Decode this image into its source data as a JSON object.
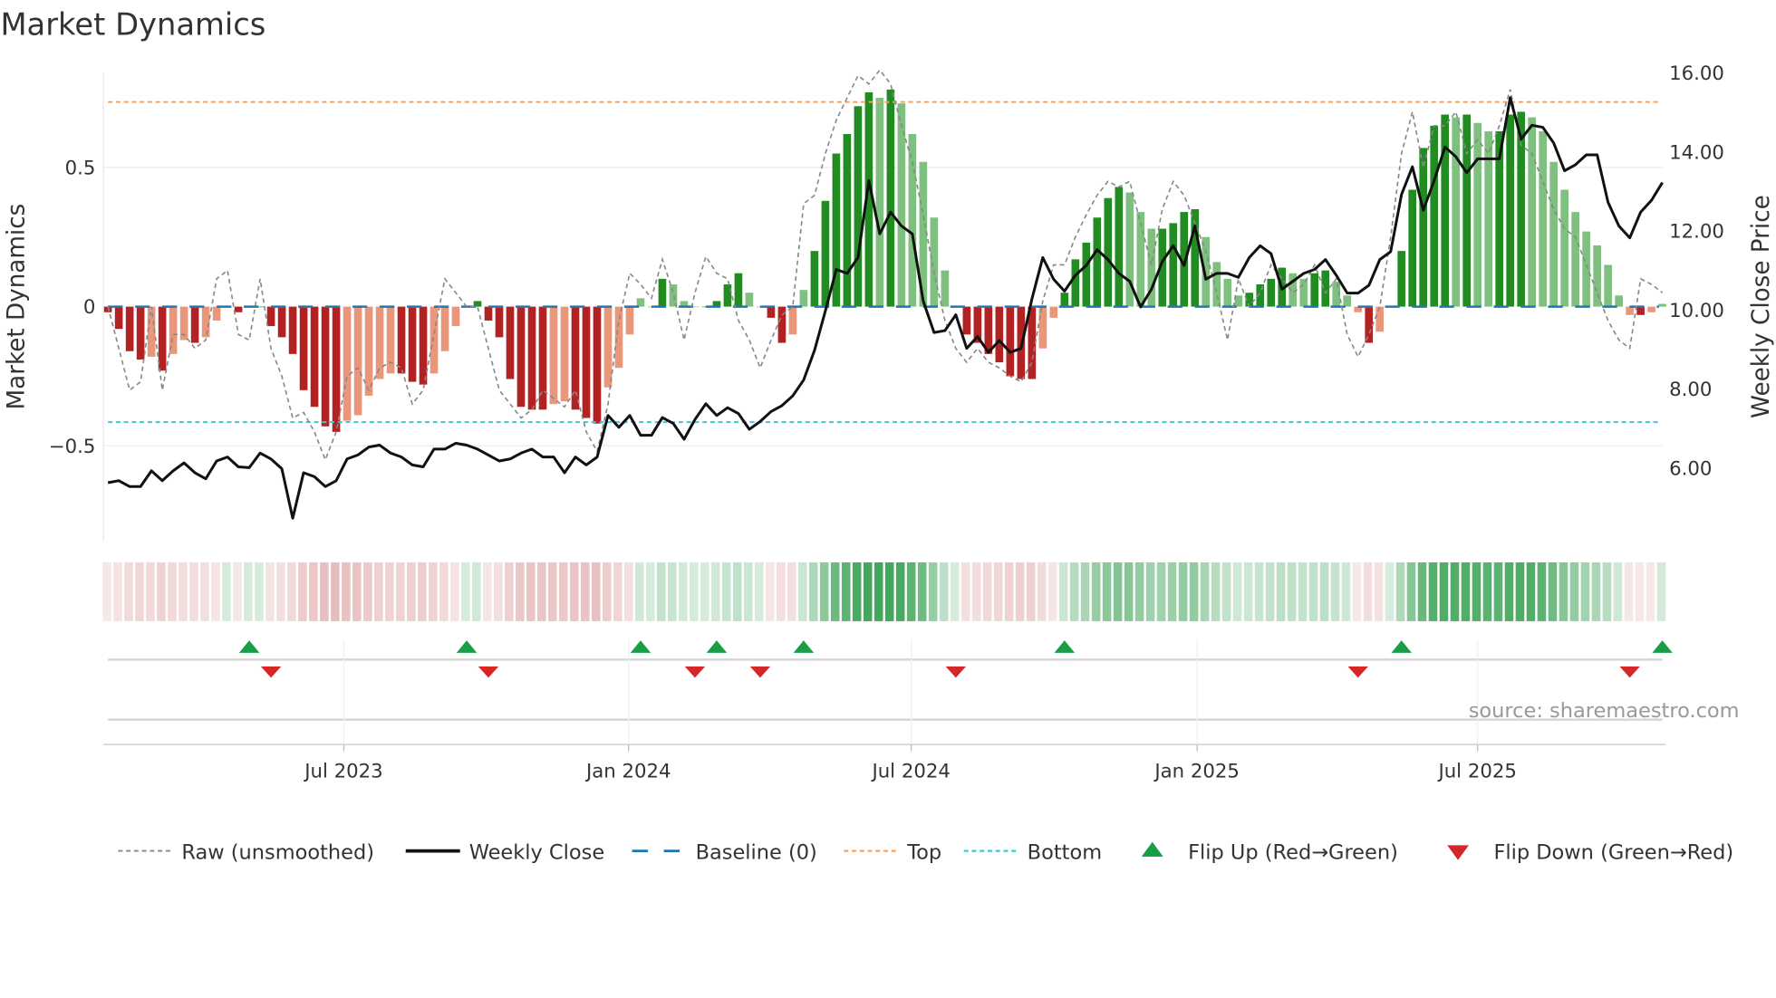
{
  "chart_data": {
    "type": "bar",
    "title": "Market Dynamics",
    "ylabel": "Market Dynamics",
    "y2label": "Weekly Close Price",
    "ylim": [
      -0.85,
      0.85
    ],
    "y2lim": [
      4.4,
      16.2
    ],
    "yticks": [
      {
        "v": 0.5,
        "label": "0.5"
      },
      {
        "v": 0,
        "label": "0"
      },
      {
        "v": -0.5,
        "label": "−0.5"
      }
    ],
    "y2ticks": [
      {
        "v": 16,
        "label": "16.00"
      },
      {
        "v": 14,
        "label": "14.00"
      },
      {
        "v": 12,
        "label": "12.00"
      },
      {
        "v": 10,
        "label": "10.00"
      },
      {
        "v": 8,
        "label": "8.00"
      },
      {
        "v": 6,
        "label": "6.00"
      }
    ],
    "xticks": [
      {
        "week": 21.7,
        "label": "Jul 2023"
      },
      {
        "week": 47.9,
        "label": "Jan 2024"
      },
      {
        "week": 73.9,
        "label": "Jul 2024"
      },
      {
        "week": 100.2,
        "label": "Jan 2025"
      },
      {
        "week": 126.0,
        "label": "Jul 2025"
      }
    ],
    "top_level": 0.735,
    "bottom_level": -0.415,
    "baseline": 0,
    "dynamics": [
      -0.02,
      -0.08,
      -0.16,
      -0.19,
      -0.18,
      -0.23,
      -0.17,
      -0.12,
      -0.13,
      -0.11,
      -0.05,
      0.0,
      -0.02,
      0.0,
      0.0,
      -0.07,
      -0.11,
      -0.17,
      -0.3,
      -0.36,
      -0.43,
      -0.45,
      -0.41,
      -0.39,
      -0.32,
      -0.26,
      -0.24,
      -0.24,
      -0.27,
      -0.28,
      -0.24,
      -0.16,
      -0.07,
      0.0,
      0.02,
      -0.05,
      -0.11,
      -0.26,
      -0.36,
      -0.37,
      -0.37,
      -0.35,
      -0.34,
      -0.37,
      -0.4,
      -0.42,
      -0.29,
      -0.22,
      -0.1,
      0.03,
      0.0,
      0.1,
      0.08,
      0.02,
      0.0,
      0.0,
      0.02,
      0.08,
      0.12,
      0.05,
      0.0,
      -0.04,
      -0.13,
      -0.1,
      0.06,
      0.2,
      0.38,
      0.55,
      0.62,
      0.72,
      0.77,
      0.75,
      0.78,
      0.73,
      0.62,
      0.52,
      0.32,
      0.13,
      0.0,
      -0.1,
      -0.13,
      -0.17,
      -0.2,
      -0.25,
      -0.26,
      -0.26,
      -0.15,
      -0.04,
      0.05,
      0.17,
      0.23,
      0.32,
      0.39,
      0.43,
      0.41,
      0.34,
      0.28,
      0.28,
      0.3,
      0.34,
      0.35,
      0.25,
      0.16,
      0.1,
      0.04,
      0.05,
      0.08,
      0.1,
      0.14,
      0.12,
      0.1,
      0.12,
      0.13,
      0.09,
      0.04,
      -0.02,
      -0.13,
      -0.09,
      0.0,
      0.2,
      0.42,
      0.57,
      0.65,
      0.69,
      0.68,
      0.69,
      0.66,
      0.63,
      0.63,
      0.69,
      0.7,
      0.68,
      0.63,
      0.52,
      0.42,
      0.34,
      0.27,
      0.22,
      0.15,
      0.04,
      -0.03,
      -0.03,
      -0.02,
      0.01
    ],
    "raw": [
      0.0,
      -0.15,
      -0.3,
      -0.27,
      0.0,
      -0.3,
      -0.1,
      -0.1,
      -0.15,
      -0.12,
      0.1,
      0.13,
      -0.1,
      -0.12,
      0.1,
      -0.15,
      -0.25,
      -0.4,
      -0.38,
      -0.45,
      -0.55,
      -0.45,
      -0.25,
      -0.22,
      -0.3,
      -0.22,
      -0.2,
      -0.22,
      -0.35,
      -0.3,
      -0.1,
      0.1,
      0.05,
      0.0,
      0.0,
      -0.15,
      -0.3,
      -0.35,
      -0.4,
      -0.37,
      -0.3,
      -0.33,
      -0.36,
      -0.3,
      -0.45,
      -0.52,
      -0.35,
      -0.05,
      0.12,
      0.08,
      0.03,
      0.17,
      0.05,
      -0.12,
      0.05,
      0.18,
      0.12,
      0.1,
      -0.05,
      -0.12,
      -0.22,
      -0.12,
      -0.03,
      0.0,
      0.37,
      0.4,
      0.55,
      0.67,
      0.75,
      0.83,
      0.8,
      0.85,
      0.8,
      0.65,
      0.52,
      0.33,
      0.12,
      -0.05,
      -0.15,
      -0.2,
      -0.15,
      -0.2,
      -0.22,
      -0.25,
      -0.27,
      -0.2,
      0.02,
      0.15,
      0.15,
      0.25,
      0.33,
      0.4,
      0.45,
      0.43,
      0.45,
      0.3,
      0.15,
      0.35,
      0.45,
      0.4,
      0.3,
      0.2,
      0.05,
      -0.12,
      0.1,
      0.0,
      0.05,
      0.15,
      0.1,
      0.05,
      0.08,
      0.15,
      0.05,
      0.1,
      -0.1,
      -0.18,
      -0.1,
      0.0,
      0.25,
      0.55,
      0.7,
      0.5,
      0.65,
      0.65,
      0.7,
      0.55,
      0.6,
      0.55,
      0.65,
      0.78,
      0.58,
      0.55,
      0.45,
      0.35,
      0.28,
      0.25,
      0.15,
      0.05,
      -0.05,
      -0.12,
      -0.15,
      0.1,
      0.08,
      0.05
    ],
    "weekly_close": [
      5.6,
      5.65,
      5.5,
      5.5,
      5.9,
      5.65,
      5.9,
      6.1,
      5.85,
      5.7,
      6.15,
      6.25,
      6.0,
      5.98,
      6.35,
      6.2,
      5.95,
      4.7,
      5.85,
      5.75,
      5.5,
      5.65,
      6.2,
      6.3,
      6.5,
      6.55,
      6.35,
      6.25,
      6.05,
      6.0,
      6.45,
      6.45,
      6.6,
      6.55,
      6.45,
      6.3,
      6.15,
      6.2,
      6.35,
      6.45,
      6.25,
      6.25,
      5.85,
      6.25,
      6.05,
      6.25,
      7.3,
      7.0,
      7.3,
      6.8,
      6.8,
      7.25,
      7.1,
      6.7,
      7.2,
      7.6,
      7.3,
      7.5,
      7.35,
      6.95,
      7.15,
      7.4,
      7.55,
      7.8,
      8.2,
      8.95,
      9.95,
      11.0,
      10.9,
      11.3,
      13.25,
      11.9,
      12.45,
      12.1,
      11.9,
      10.2,
      9.4,
      9.45,
      9.85,
      9.0,
      9.3,
      8.9,
      9.2,
      8.9,
      9.0,
      10.25,
      11.3,
      10.75,
      10.45,
      10.85,
      11.1,
      11.5,
      11.25,
      10.9,
      10.7,
      10.05,
      10.5,
      11.2,
      11.6,
      11.1,
      12.1,
      10.75,
      10.9,
      10.9,
      10.8,
      11.3,
      11.6,
      11.4,
      10.5,
      10.7,
      10.9,
      11.0,
      11.25,
      10.85,
      10.4,
      10.4,
      10.6,
      11.25,
      11.45,
      12.9,
      13.6,
      12.5,
      13.25,
      14.1,
      13.85,
      13.45,
      13.8,
      13.8,
      13.8,
      15.35,
      14.3,
      14.65,
      14.6,
      14.2,
      13.5,
      13.65,
      13.9,
      13.9,
      12.7,
      12.1,
      11.8,
      12.45,
      12.75,
      13.2
    ],
    "flip_up_weeks": [
      13,
      33,
      49,
      56,
      64,
      88,
      119,
      143
    ],
    "flip_down_weeks": [
      15,
      35,
      54,
      60,
      78,
      115,
      140
    ],
    "legend": [
      {
        "label": "Raw (unsmoothed)",
        "style": "raw"
      },
      {
        "label": "Weekly Close",
        "style": "close"
      },
      {
        "label": "Baseline (0)",
        "style": "baseline"
      },
      {
        "label": "Top",
        "style": "top"
      },
      {
        "label": "Bottom",
        "style": "bottom"
      },
      {
        "label": "Flip Up (Red→Green)",
        "style": "up"
      },
      {
        "label": "Flip Down (Green→Red)",
        "style": "down"
      }
    ],
    "legend_position": "bottom",
    "colors": {
      "pos_strong": "#228b22",
      "pos_weak": "#7fbf7f",
      "neg_strong": "#b22222",
      "neg_weak": "#e9967a",
      "raw": "#888888",
      "close": "#111111",
      "baseline": "#1f77b4",
      "top": "#f4a460",
      "bottom": "#40c4d8",
      "flip_up": "#1a9e45",
      "flip_down": "#d62728",
      "heat_pos": "#2e9e4a",
      "heat_neg": "#c0504d"
    }
  },
  "source": "source: sharemaestro.com"
}
